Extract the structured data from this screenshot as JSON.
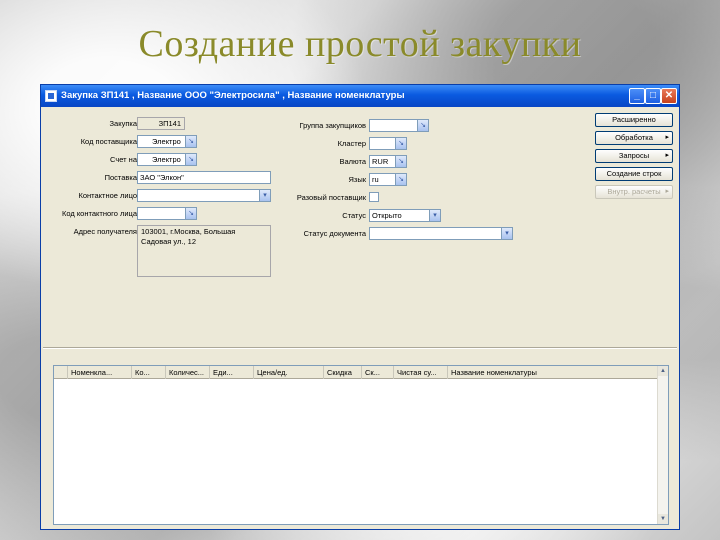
{
  "slide": {
    "title": "Создание простой закупки"
  },
  "window": {
    "title": "Закупка ЗП141 , Название ООО \"Электросила\" , Название номенклатуры",
    "min_glyph": "_",
    "max_glyph": "□",
    "close_glyph": "✕"
  },
  "form_left": {
    "purchase_label": "Закупка",
    "purchase_value": "ЗП141",
    "supplier_code_label": "Код поставщика",
    "supplier_code_value": "Электро",
    "invoice_to_label": "Счет на",
    "invoice_to_value": "Электро",
    "supply_label": "Поставка",
    "supply_value": "ЗАО \"Элкон\"",
    "contact_label": "Контактное лицо",
    "contact_value": "",
    "contact_code_label": "Код контактного лица",
    "contact_code_value": "",
    "recipient_address_label": "Адрес получателя",
    "recipient_address_value": "103001, г.Москва, Большая Садовая ул., 12"
  },
  "form_right": {
    "purchase_group_label": "Группа закупщиков",
    "purchase_group_value": "",
    "cluster_label": "Кластер",
    "cluster_value": "",
    "currency_label": "Валюта",
    "currency_value": "RUR",
    "language_label": "Язык",
    "language_value": "ru",
    "one_time_supplier_label": "Разовый поставщик",
    "status_label": "Статус",
    "status_value": "Открыто",
    "document_status_label": "Статус документа",
    "document_status_value": ""
  },
  "side_buttons": {
    "extended": "Расширенно",
    "processing": "Обработка",
    "requests": "Запросы",
    "create_line": "Создание строк",
    "internal_calc": "Внутр. расчеты",
    "arrow": "▸"
  },
  "lines_table": {
    "columns": [
      "",
      "Номенкла...",
      "Ко...",
      "Количес...",
      "Еди...",
      "Цена/ед.",
      "Скидка",
      "Ск...",
      "Чистая су...",
      "Название номенклатуры"
    ]
  },
  "icons": {
    "lookup": "lookup-icon",
    "dropdown": "dropdown-arrow-icon",
    "lookup_glyph": "↘",
    "dropdown_glyph": "▾",
    "scroll_up_glyph": "▲",
    "scroll_down_glyph": "▼"
  },
  "colors": {
    "title_bar": "#0a5ae0",
    "slide_title": "#8a8a2a",
    "window_bg": "#ece9d8"
  }
}
